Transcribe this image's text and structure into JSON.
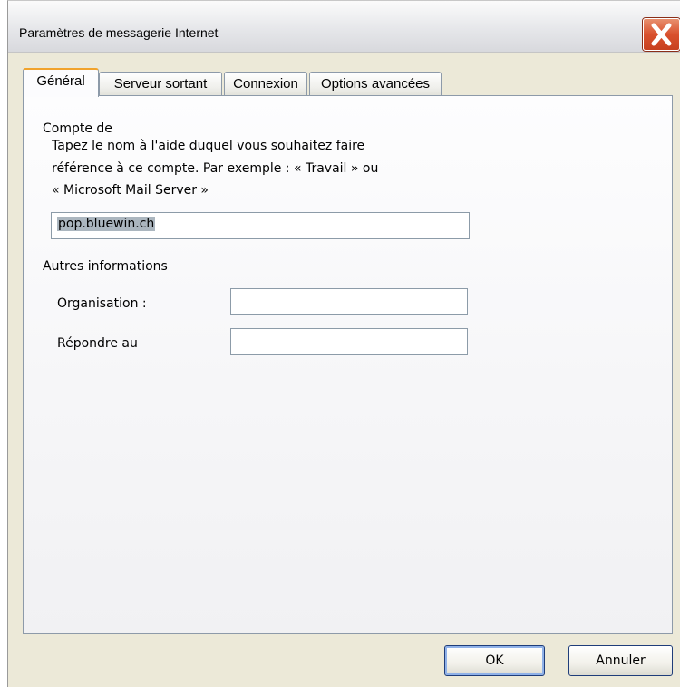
{
  "window": {
    "title": "Paramètres de messagerie Internet",
    "close_icon": "close-x-icon"
  },
  "tabs": [
    {
      "label": "Général",
      "active": true
    },
    {
      "label": "Serveur sortant",
      "active": false
    },
    {
      "label": "Connexion",
      "active": false
    },
    {
      "label": "Options avancées",
      "active": false
    }
  ],
  "account": {
    "section_title": "Compte de",
    "description_line1": "Tapez le nom à l'aide duquel vous souhaitez faire",
    "description_line2": "référence à ce compte. Par exemple : « Travail » ou",
    "description_line3": "« Microsoft Mail Server »",
    "name_value": "pop.bluewin.ch"
  },
  "other_info": {
    "section_title": "Autres informations",
    "organisation_label": "Organisation :",
    "organisation_value": "",
    "reply_label": "Répondre au",
    "reply_value": ""
  },
  "footer": {
    "ok_label": "OK",
    "cancel_label": "Annuler"
  },
  "colors": {
    "close_button": "#d9502d",
    "active_tab_accent": "#f1a32c",
    "selection_highlight": "#abb6bf"
  }
}
